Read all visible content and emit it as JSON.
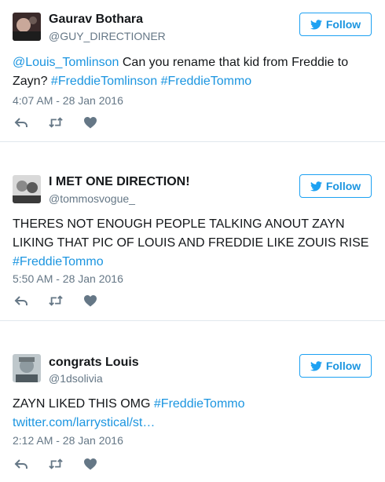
{
  "follow_label": "Follow",
  "tweets": [
    {
      "name": "Gaurav Bothara",
      "handle": "@GUY_DIRECTIONER",
      "text": [
        {
          "t": "@Louis_Tomlinson",
          "link": true
        },
        {
          "t": " Can you rename that kid from Freddie to Zayn? ",
          "link": false
        },
        {
          "t": "#FreddieTomlinson",
          "link": true
        },
        {
          "t": " ",
          "link": false
        },
        {
          "t": "#FreddieTommo",
          "link": true
        }
      ],
      "time": "4:07 AM - 28 Jan 2016"
    },
    {
      "name": "I MET ONE DIRECTION!",
      "handle": "@tommosvogue_",
      "text": [
        {
          "t": "THERES NOT ENOUGH PEOPLE TALKING ANOUT ZAYN LIKING THAT PIC OF LOUIS AND FREDDIE LIKE ZOUIS RISE ",
          "link": false
        },
        {
          "t": "#FreddieTommo",
          "link": true
        }
      ],
      "time": "5:50 AM - 28 Jan 2016"
    },
    {
      "name": "congrats Louis",
      "handle": "@1dsolivia",
      "text": [
        {
          "t": "ZAYN LIKED THIS OMG ",
          "link": false
        },
        {
          "t": "#FreddieTommo",
          "link": true
        },
        {
          "t": " twitter.com/larrystical/st…",
          "link": true
        }
      ],
      "time": "2:12 AM - 28 Jan 2016"
    }
  ],
  "colors": {
    "link": "#1b95e0",
    "meta": "#657786",
    "icon": "#657786",
    "border": "#e1e8ed"
  },
  "icons": [
    "bird-icon",
    "reply-icon",
    "retweet-icon",
    "like-icon"
  ]
}
